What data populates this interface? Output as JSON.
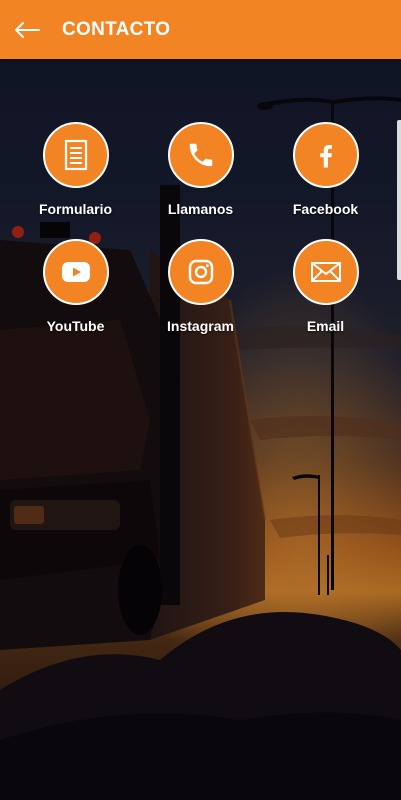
{
  "app_bar": {
    "title": "CONTACTO",
    "back_icon": "arrow-left-icon",
    "color": "#f28424"
  },
  "contact_options": [
    {
      "label": "Formulario",
      "icon": "form-document-icon"
    },
    {
      "label": "Llamanos",
      "icon": "phone-icon"
    },
    {
      "label": "Facebook",
      "icon": "facebook-icon"
    },
    {
      "label": "YouTube",
      "icon": "youtube-icon"
    },
    {
      "label": "Instagram",
      "icon": "instagram-icon"
    },
    {
      "label": "Email",
      "icon": "email-icon"
    }
  ],
  "colors": {
    "accent": "#f28424",
    "icon_border": "#ffffff",
    "label_text": "#ffffff"
  }
}
